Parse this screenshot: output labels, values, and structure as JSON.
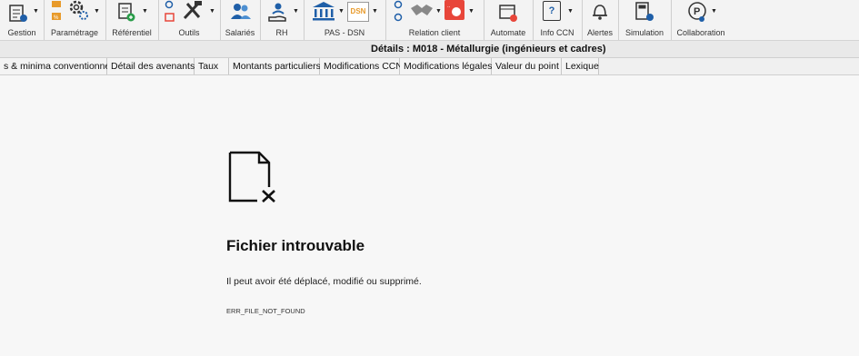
{
  "ribbon": {
    "groups": [
      {
        "label": "Gestion"
      },
      {
        "label": "Paramétrage"
      },
      {
        "label": "Référentiel"
      },
      {
        "label": "Outils"
      },
      {
        "label": "Salariés"
      },
      {
        "label": "RH"
      },
      {
        "label": "PAS - DSN"
      },
      {
        "label": "Relation client"
      },
      {
        "label": "Automate"
      },
      {
        "label": "Info CCN"
      },
      {
        "label": "Alertes"
      },
      {
        "label": "Simulation"
      },
      {
        "label": "Collaboration"
      }
    ],
    "dsn_badge": "DSN",
    "info_badge": "?"
  },
  "details": {
    "title": "Détails : M018 - Métallurgie (ingénieurs et cadres)"
  },
  "tabs": [
    {
      "label": "s & minima conventionnels"
    },
    {
      "label": "Détail des avenants"
    },
    {
      "label": "Taux"
    },
    {
      "label": "Montants particuliers"
    },
    {
      "label": "Modifications CCN"
    },
    {
      "label": "Modifications légales"
    },
    {
      "label": "Valeur du point"
    },
    {
      "label": "Lexique"
    }
  ],
  "error": {
    "title": "Fichier introuvable",
    "message": "Il peut avoir été déplacé, modifié ou supprimé.",
    "code": "ERR_FILE_NOT_FOUND"
  },
  "colors": {
    "accent_blue": "#1f5fa8",
    "accent_red": "#e8463a",
    "accent_orange": "#e89a2a"
  }
}
